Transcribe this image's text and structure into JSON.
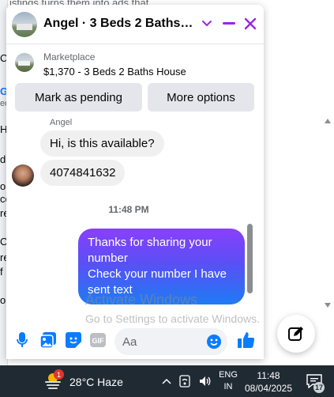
{
  "background": {
    "top_text": "istings turns them into ads that",
    "fragments": [
      "C",
      "Gr",
      "ed",
      "Ho",
      "d",
      "o",
      "co",
      "re",
      "O",
      "re",
      "f",
      "ou"
    ]
  },
  "chat": {
    "title": "Angel · 3 Beds 2 Baths House",
    "listing": {
      "source": "Marketplace",
      "title": "$1,370 - 3 Beds 2 Baths House"
    },
    "actions": {
      "mark_pending": "Mark as pending",
      "more_options": "More options"
    },
    "messages": {
      "sender_name": "Angel",
      "incoming": [
        "Hi, is this available?",
        "4074841632"
      ],
      "timestamp": "11:48 PM",
      "outgoing": [
        "Thanks for sharing your number",
        "Check your number I have sent text"
      ]
    },
    "composer": {
      "placeholder": "Aa"
    },
    "accent_color": "#9b23ea"
  },
  "watermark": {
    "line1": "Activate Windows",
    "line2": "Go to Settings to activate Windows."
  },
  "taskbar": {
    "weather_badge": "1",
    "weather_text": "28°C  Haze",
    "lang_line1": "ENG",
    "lang_line2": "IN",
    "time": "11:48",
    "date": "08/04/2025",
    "notification_count": "17"
  }
}
